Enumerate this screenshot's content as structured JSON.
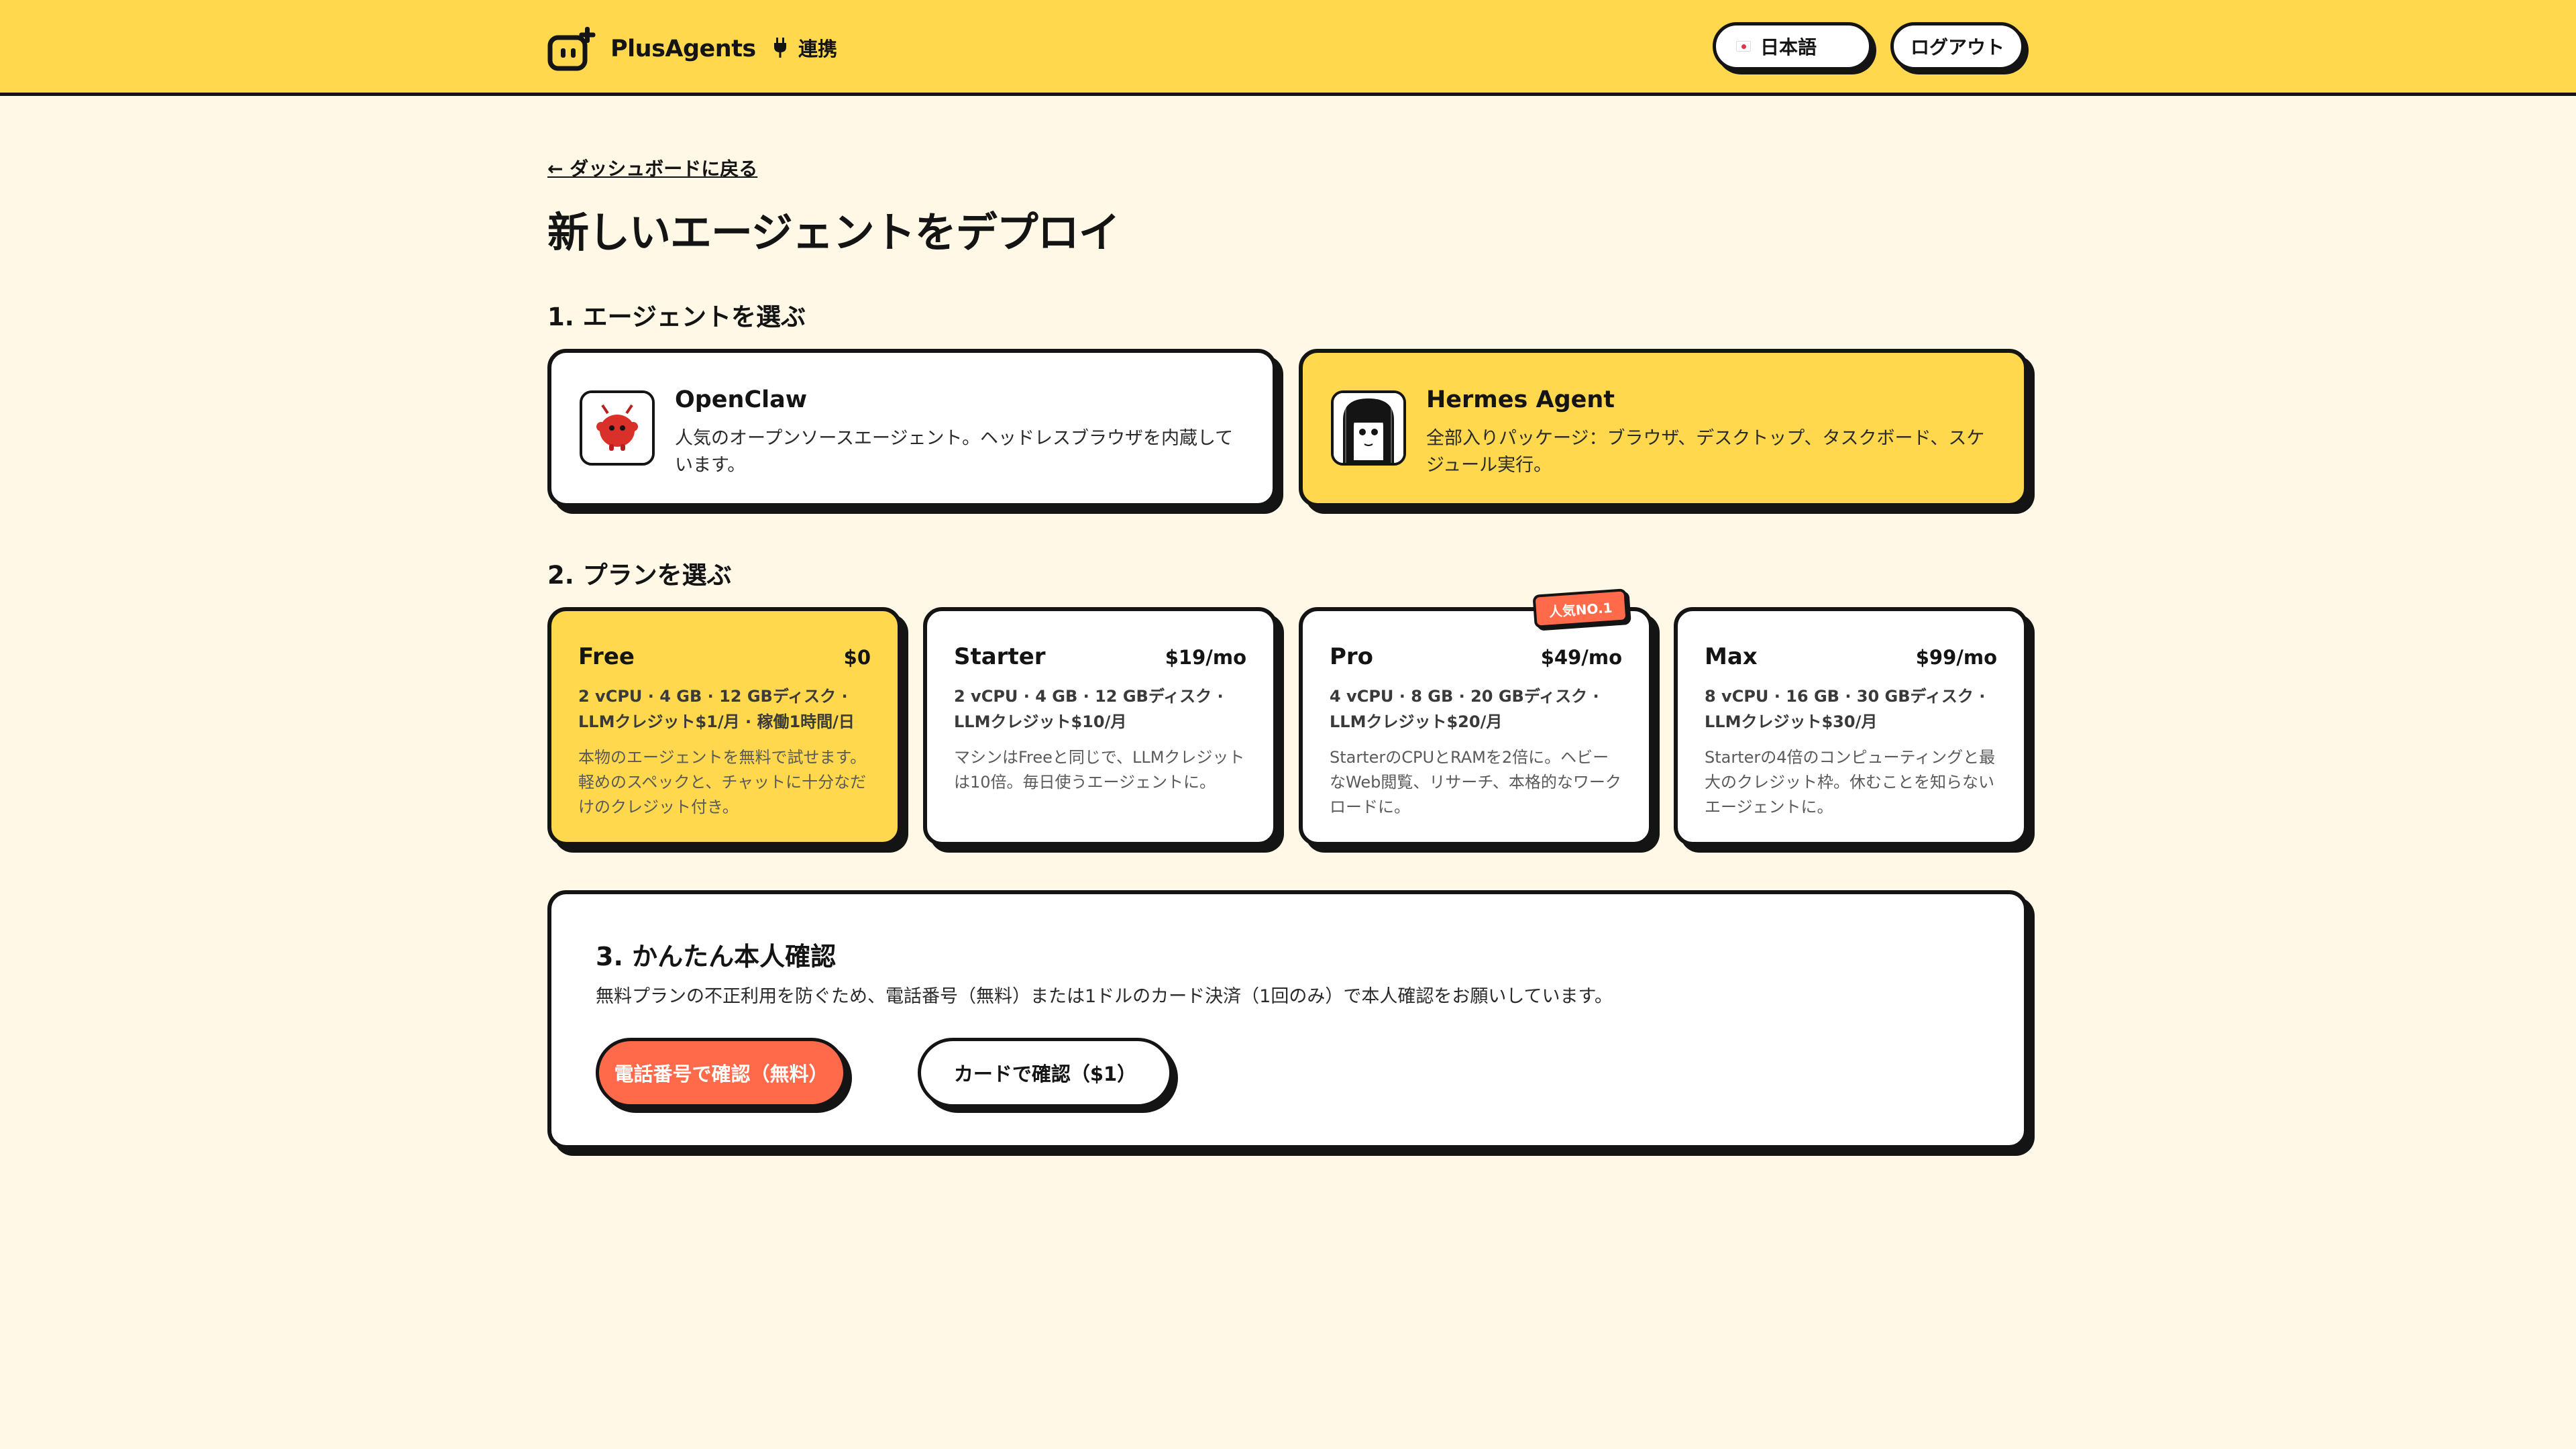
{
  "header": {
    "brand": "PlusAgents",
    "nav_integrations": "連携",
    "language": "日本語",
    "logout": "ログアウト"
  },
  "main": {
    "back_link": "← ダッシュボードに戻る",
    "title": "新しいエージェントをデプロイ",
    "step1_title": "1. エージェントを選ぶ",
    "agents": [
      {
        "name": "OpenClaw",
        "description": "人気のオープンソースエージェント。ヘッドレスブラウザを内蔵しています。",
        "selected": false
      },
      {
        "name": "Hermes Agent",
        "description": "全部入りパッケージ：ブラウザ、デスクトップ、タスクボード、スケジュール実行。",
        "selected": true
      }
    ],
    "step2_title": "2. プランを選ぶ",
    "plans": [
      {
        "name": "Free",
        "price": "$0",
        "spec": "2 vCPU · 4 GB · 12 GBディスク · LLMクレジット$1/月 · 稼働1時間/日",
        "description": "本物のエージェントを無料で試せます。軽めのスペックと、チャットに十分なだけのクレジット付き。",
        "selected": true
      },
      {
        "name": "Starter",
        "price": "$19/mo",
        "spec": "2 vCPU · 4 GB · 12 GBディスク · LLMクレジット$10/月",
        "description": "マシンはFreeと同じで、LLMクレジットは10倍。毎日使うエージェントに。",
        "selected": false
      },
      {
        "name": "Pro",
        "price": "$49/mo",
        "spec": "4 vCPU · 8 GB · 20 GBディスク · LLMクレジット$20/月",
        "description": "StarterのCPUとRAMを2倍に。ヘビーなWeb閲覧、リサーチ、本格的なワークロードに。",
        "selected": false,
        "badge": "人気NO.1"
      },
      {
        "name": "Max",
        "price": "$99/mo",
        "spec": "8 vCPU · 16 GB · 30 GBディスク · LLMクレジット$30/月",
        "description": "Starterの4倍のコンピューティングと最大のクレジット枠。休むことを知らないエージェントに。",
        "selected": false
      }
    ],
    "step3_title": "3. かんたん本人確認",
    "step3_description": "無料プランの不正利用を防ぐため、電話番号（無料）または1ドルのカード決済（1回のみ）で本人確認をお願いしています。",
    "verify_phone": "電話番号で確認（無料）",
    "verify_card": "カードで確認（$1）"
  },
  "colors": {
    "header_bg": "#FFD84D",
    "page_bg": "#FFF8E6",
    "selected_bg": "#FFD84D",
    "accent": "#FF6B4A",
    "ink": "#141414"
  },
  "icons": {
    "brand": "robot-plus-icon",
    "integrations": "plug-icon",
    "language": "japan-flag-icon"
  }
}
